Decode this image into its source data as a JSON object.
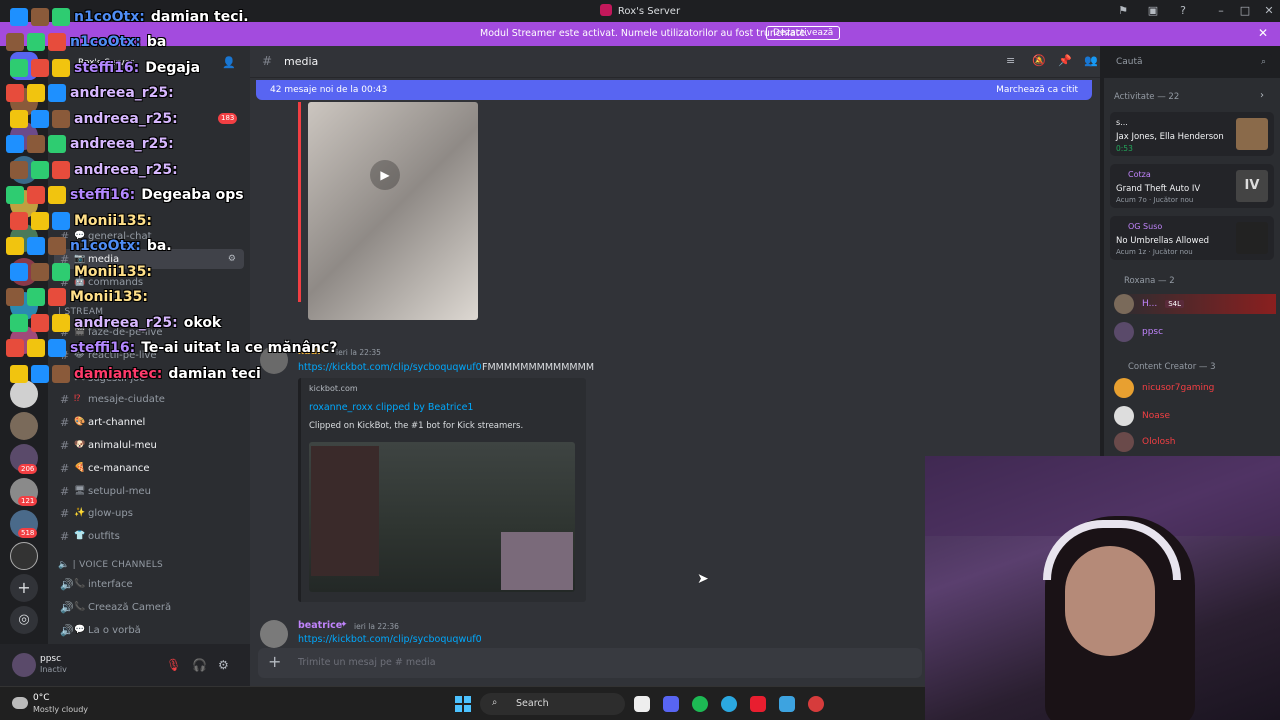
{
  "window": {
    "title": "Rox's Server"
  },
  "banner": {
    "message": "Modul Streamer este activat. Numele utilizatorilor au fost trunchiate.",
    "button": "Dezactivează"
  },
  "sidebar": {
    "server_name": "Rox's Server",
    "channels_top": [
      {
        "label": "general-chat"
      },
      {
        "label": "media",
        "active": true
      },
      {
        "label": "commands"
      }
    ],
    "category_stream": "| STREAM",
    "channels_stream": [
      {
        "label": "faze-de-pe-live"
      },
      {
        "label": "reactii-pe-live"
      },
      {
        "label": "sugestii-joc"
      },
      {
        "label": "mesaje-ciudate"
      },
      {
        "label": "art-channel"
      },
      {
        "label": "animalul-meu"
      },
      {
        "label": "ce-manance"
      },
      {
        "label": "setupul-meu"
      },
      {
        "label": "glow-ups"
      },
      {
        "label": "outfits"
      }
    ],
    "category_voice": "| VOICE CHANNELS",
    "voice_channels": [
      {
        "label": "interface"
      },
      {
        "label": "Creează Cameră"
      },
      {
        "label": "La o vorbă"
      }
    ],
    "badge_183": "183"
  },
  "user": {
    "name": "ppsc",
    "status": "Inactiv"
  },
  "rail_badges": [
    "206",
    "121",
    "518"
  ],
  "chat": {
    "channel": "media",
    "search_placeholder": "Caută",
    "new_messages": "42 mesaje noi de la 00:43",
    "mark_read": "Marchează ca citit",
    "messages": [
      {
        "author": "xadi",
        "time": "ieri la 22:35",
        "link": "https://kickbot.com/clip/sycboquqwuf0",
        "text": "FMMMMMMMMMMMMM",
        "embed_site": "kickbot.com",
        "embed_title": "roxanne_roxx clipped by Beatrice1",
        "embed_desc": "Clipped on KickBot, the #1 bot for Kick streamers."
      },
      {
        "author": "beatrice",
        "time": "ieri la 22:36",
        "link": "https://kickbot.com/clip/sycboquqwuf0"
      }
    ],
    "composer_placeholder": "Trimite un mesaj pe #",
    "composer_channel": "media"
  },
  "members": {
    "activity_header": "Activitate — 22",
    "activities": [
      {
        "user": "s...",
        "title": "Jax Jones, Ella Henderson",
        "sub": "0:53"
      },
      {
        "user": "Cotza",
        "title": "Grand Theft Auto IV",
        "sub": "Acum 7o",
        "sub2": "Jucător nou"
      },
      {
        "user": "OG Suso",
        "title": "No Umbrellas Allowed",
        "sub": "Acum 1z",
        "sub2": "Jucător nou"
      }
    ],
    "roxana_header": "Roxana — 2",
    "roxana_members": [
      {
        "name": "H..."
      },
      {
        "name": "ppsc"
      }
    ],
    "creator_header": "Content Creator — 3",
    "creator_members": [
      {
        "name": "nicusor7gaming"
      },
      {
        "name": "Noase"
      },
      {
        "name": "Ololosh"
      }
    ],
    "tag_s4l": "S4L"
  },
  "overlay_chat": [
    {
      "user": "n1coOtx:",
      "msg": "damian teci.",
      "color": "#4f8df5"
    },
    {
      "user": "n1coOtx:",
      "msg": "ba",
      "color": "#4f8df5"
    },
    {
      "user": "steffi16:",
      "msg": "Degaja",
      "color": "#b388ff"
    },
    {
      "user": "andreea_r25:",
      "msg": "",
      "color": "#d7b8ff"
    },
    {
      "user": "andreea_r25:",
      "msg": "",
      "color": "#d7b8ff"
    },
    {
      "user": "andreea_r25:",
      "msg": "",
      "color": "#d7b8ff"
    },
    {
      "user": "andreea_r25:",
      "msg": "",
      "color": "#d7b8ff"
    },
    {
      "user": "steffi16:",
      "msg": "Degeaba ops",
      "color": "#b388ff"
    },
    {
      "user": "Monii135:",
      "msg": "",
      "color": "#ffe08a"
    },
    {
      "user": "n1coOtx:",
      "msg": "ba.",
      "color": "#4f8df5"
    },
    {
      "user": "Monii135:",
      "msg": "",
      "color": "#ffe08a"
    },
    {
      "user": "Monii135:",
      "msg": "",
      "color": "#ffe08a"
    },
    {
      "user": "andreea_r25:",
      "msg": "okok",
      "color": "#d7b8ff"
    },
    {
      "user": "steffi16:",
      "msg": "Te-ai uitat la ce mănânc?",
      "color": "#b388ff"
    },
    {
      "user": "damiantec:",
      "msg": "damian teci",
      "color": "#ff3b6b"
    }
  ],
  "taskbar": {
    "temp": "0°C",
    "weather": "Mostly cloudy",
    "search": "Search"
  },
  "colors": {
    "accent": "#5865f2",
    "banner": "#a34bde",
    "link": "#00a8fc"
  }
}
